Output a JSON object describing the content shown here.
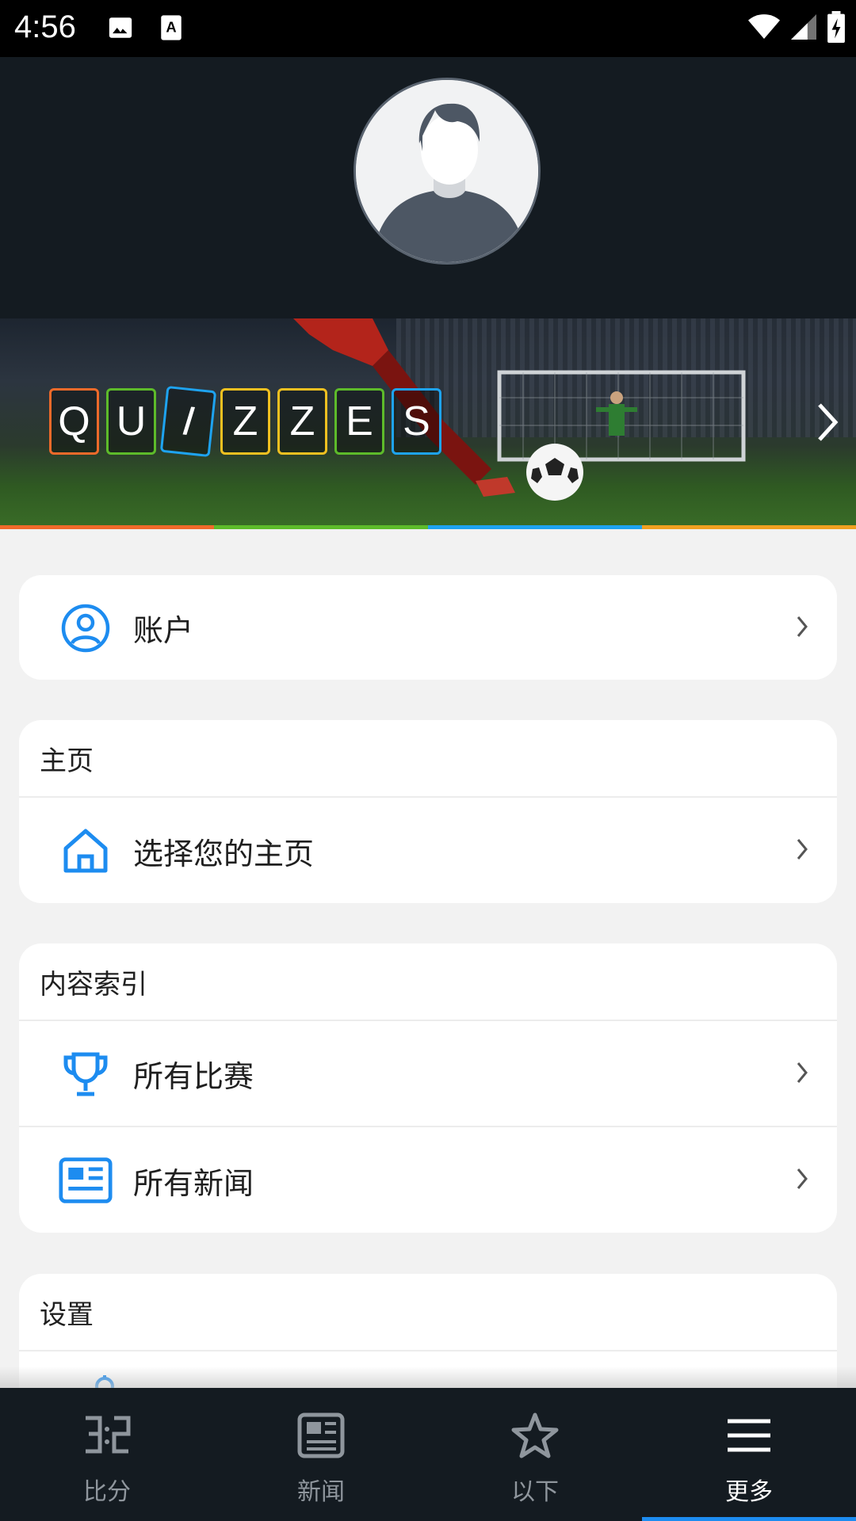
{
  "status_bar": {
    "time": "4:56",
    "left_icons": [
      "image-icon",
      "text-icon"
    ],
    "right_icons": [
      "wifi-icon",
      "signal-icon",
      "battery-charging-icon"
    ]
  },
  "profile": {
    "avatar_icon": "person-avatar-icon"
  },
  "quiz_banner": {
    "letters": [
      "Q",
      "U",
      "I",
      "Z",
      "Z",
      "E",
      "S"
    ],
    "letter_colors": [
      "#f06a2a",
      "#5dbb2a",
      "#1ea3f0",
      "#f0c020",
      "#f0c020",
      "#5dbb2a",
      "#1ea3f0"
    ],
    "underline_colors": [
      "#f06a2a",
      "#5dbb2a",
      "#1ea3f0",
      "#f0a020"
    ]
  },
  "account_card": {
    "label": "账户",
    "icon": "account-circle-icon"
  },
  "home_card": {
    "header": "主页",
    "rows": [
      {
        "label": "选择您的主页",
        "icon": "home-icon"
      }
    ]
  },
  "content_card": {
    "header": "内容索引",
    "rows": [
      {
        "label": "所有比赛",
        "icon": "trophy-icon"
      },
      {
        "label": "所有新闻",
        "icon": "news-icon"
      }
    ]
  },
  "settings_card": {
    "header": "设置"
  },
  "bottom_nav": {
    "items": [
      {
        "label": "比分",
        "icon": "score-icon"
      },
      {
        "label": "新闻",
        "icon": "news-icon"
      },
      {
        "label": "以下",
        "icon": "star-icon"
      },
      {
        "label": "更多",
        "icon": "menu-icon"
      }
    ],
    "active_index": 3
  },
  "colors": {
    "accent": "#1d8cf0",
    "dark_bg": "#141b21",
    "page_bg": "#f2f2f2"
  }
}
